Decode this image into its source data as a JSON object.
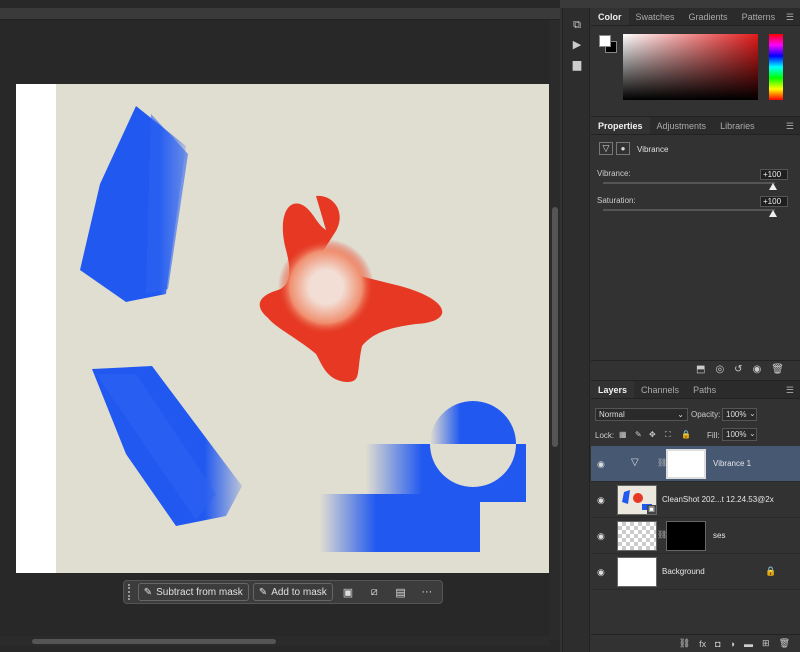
{
  "panels": {
    "color_tabs": [
      "Color",
      "Swatches",
      "Gradients",
      "Patterns"
    ],
    "properties_tabs": [
      "Properties",
      "Adjustments",
      "Libraries"
    ],
    "layers_tabs": [
      "Layers",
      "Channels",
      "Paths"
    ]
  },
  "properties": {
    "adjustment_name": "Vibrance",
    "vibrance_label": "Vibrance:",
    "vibrance_value": "+100",
    "saturation_label": "Saturation:",
    "saturation_value": "+100"
  },
  "layers": {
    "blend_mode": "Normal",
    "opacity_label": "Opacity:",
    "opacity_value": "100%",
    "lock_label": "Lock:",
    "fill_label": "Fill:",
    "fill_value": "100%",
    "items": [
      {
        "name": "Vibrance 1"
      },
      {
        "name": "CleanShot 202...t 12.24.53@2x"
      },
      {
        "name": "ses"
      },
      {
        "name": "Background"
      }
    ]
  },
  "taskbar": {
    "subtract_label": "Subtract from mask",
    "add_label": "Add to mask",
    "more": "···"
  },
  "colors": {
    "canvas_bg": "#e0ddd1",
    "blue_shape": "#2159f0",
    "red_shape": "#e63822",
    "selected_layer": "#465872"
  }
}
